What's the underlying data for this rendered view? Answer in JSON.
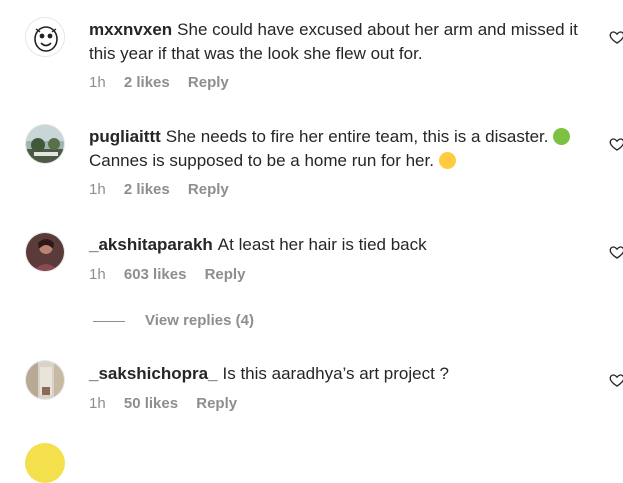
{
  "comments": [
    {
      "username": "mxxnvxen",
      "text": "She could have excused about her arm and missed it this year if that was the look she flew out for.",
      "time": "1h",
      "likes": "2 likes",
      "reply": "Reply"
    },
    {
      "username": "pugliaittt",
      "text_a": "She needs to fire her entire team, this is a disaster.",
      "text_b": "Cannes is supposed to be a home run for her.",
      "emoji_a": "nauseated-face-emoji",
      "emoji_b": "melting-face-emoji",
      "time": "1h",
      "likes": "2 likes",
      "reply": "Reply"
    },
    {
      "username": "_akshitaparakh",
      "text": "At least her hair is tied back",
      "time": "1h",
      "likes": "603 likes",
      "reply": "Reply",
      "view_replies": "View replies (4)"
    },
    {
      "username": "_sakshichopra_",
      "text": "Is this aaradhya’s art project ?",
      "time": "1h",
      "likes": "50 likes",
      "reply": "Reply"
    }
  ],
  "colors": {
    "text": "#262626",
    "secondary": "#8e8e8e"
  }
}
